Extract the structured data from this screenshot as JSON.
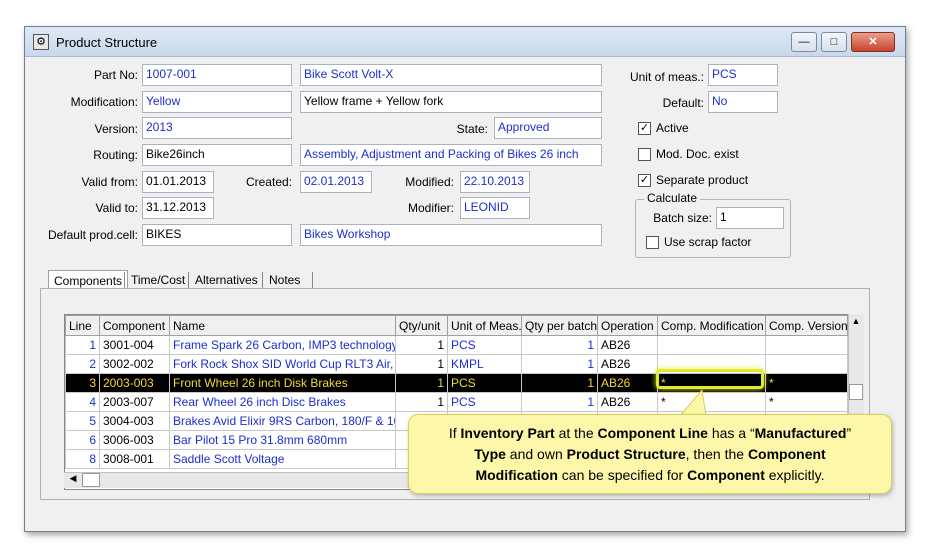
{
  "window": {
    "title": "Product Structure",
    "buttons": {
      "minimize": "—",
      "maximize": "□",
      "close": "✕"
    }
  },
  "form": {
    "part_no": {
      "label": "Part No:",
      "value": "1007-001",
      "description": "Bike Scott Volt-X"
    },
    "modification": {
      "label": "Modification:",
      "value": "Yellow",
      "description": "Yellow frame + Yellow fork"
    },
    "version": {
      "label": "Version:",
      "value": "2013"
    },
    "state": {
      "label": "State:",
      "value": "Approved"
    },
    "routing": {
      "label": "Routing:",
      "value": "Bike26inch",
      "description": "Assembly, Adjustment and Packing of Bikes 26 inch"
    },
    "valid_from": {
      "label": "Valid from:",
      "value": "01.01.2013"
    },
    "created": {
      "label": "Created:",
      "value": "02.01.2013"
    },
    "modified": {
      "label": "Modified:",
      "value": "22.10.2013"
    },
    "valid_to": {
      "label": "Valid to:",
      "value": "31.12.2013"
    },
    "modifier": {
      "label": "Modifier:",
      "value": "LEONID"
    },
    "default_prod_cell": {
      "label": "Default prod.cell:",
      "value": "BIKES",
      "description": "Bikes Workshop"
    },
    "unit_of_meas": {
      "label": "Unit of meas.:",
      "value": "PCS"
    },
    "default": {
      "label": "Default:",
      "value": "No"
    },
    "active": {
      "label": "Active",
      "checked": true
    },
    "mod_doc_exist": {
      "label": "Mod. Doc. exist",
      "checked": false
    },
    "separate_product": {
      "label": "Separate product",
      "checked": true
    },
    "calculate": {
      "legend": "Calculate",
      "batch_size": {
        "label": "Batch size:",
        "value": "1"
      },
      "use_scrap_factor": {
        "label": "Use scrap factor",
        "checked": false
      }
    }
  },
  "tabs": [
    "Components",
    "Time/Cost",
    "Alternatives",
    "Notes"
  ],
  "grid": {
    "columns": [
      "Line",
      "Component",
      "Name",
      "Qty/unit",
      "Unit of Meas.",
      "Qty per batch",
      "Operation",
      "Comp. Modification",
      "Comp. Version"
    ],
    "rows": [
      {
        "line": "1",
        "component": "3001-004",
        "name": "Frame Spark 26 Carbon, IMP3 technology,",
        "qty_unit": "1",
        "uom": "PCS",
        "qty_batch": "1",
        "operation": "AB26",
        "comp_mod": "",
        "comp_ver": ""
      },
      {
        "line": "2",
        "component": "3002-002",
        "name": "Fork Rock Shox SID World Cup RLT3 Air,",
        "qty_unit": "1",
        "uom": "KMPL",
        "qty_batch": "1",
        "operation": "AB26",
        "comp_mod": "",
        "comp_ver": ""
      },
      {
        "line": "3",
        "component": "2003-003",
        "name": "Front Wheel 26 inch Disk Brakes",
        "qty_unit": "1",
        "uom": "PCS",
        "qty_batch": "1",
        "operation": "AB26",
        "comp_mod": "*",
        "comp_ver": "*"
      },
      {
        "line": "4",
        "component": "2003-007",
        "name": "Rear Wheel 26 inch Disc Brakes",
        "qty_unit": "1",
        "uom": "PCS",
        "qty_batch": "1",
        "operation": "AB26",
        "comp_mod": "*",
        "comp_ver": "*"
      },
      {
        "line": "5",
        "component": "3004-003",
        "name": "Brakes Avid Elixir 9RS Carbon, 180/F & 16",
        "qty_unit": "",
        "uom": "",
        "qty_batch": "",
        "operation": "",
        "comp_mod": "",
        "comp_ver": ""
      },
      {
        "line": "6",
        "component": "3006-003",
        "name": "Bar Pilot 15 Pro 31.8mm 680mm",
        "qty_unit": "",
        "uom": "",
        "qty_batch": "",
        "operation": "",
        "comp_mod": "",
        "comp_ver": ""
      },
      {
        "line": "8",
        "component": "3008-001",
        "name": "Saddle Scott Voltage",
        "qty_unit": "",
        "uom": "",
        "qty_batch": "",
        "operation": "",
        "comp_mod": "",
        "comp_ver": ""
      }
    ],
    "selected_index": 2
  },
  "callout": {
    "p1": "If ",
    "b1": "Inventory Part",
    "p2": " at the ",
    "b2": "Component Line",
    "p3": " has a “",
    "b3": "Manufactured",
    "p4": "”",
    "b4": "Type",
    "p5": " and own ",
    "b5": "Product Structure",
    "p6": ", then the ",
    "b6": "Component",
    "b7": "Modification",
    "p7": " can be specified for ",
    "b8": "Component",
    "p8": " explicitly."
  }
}
